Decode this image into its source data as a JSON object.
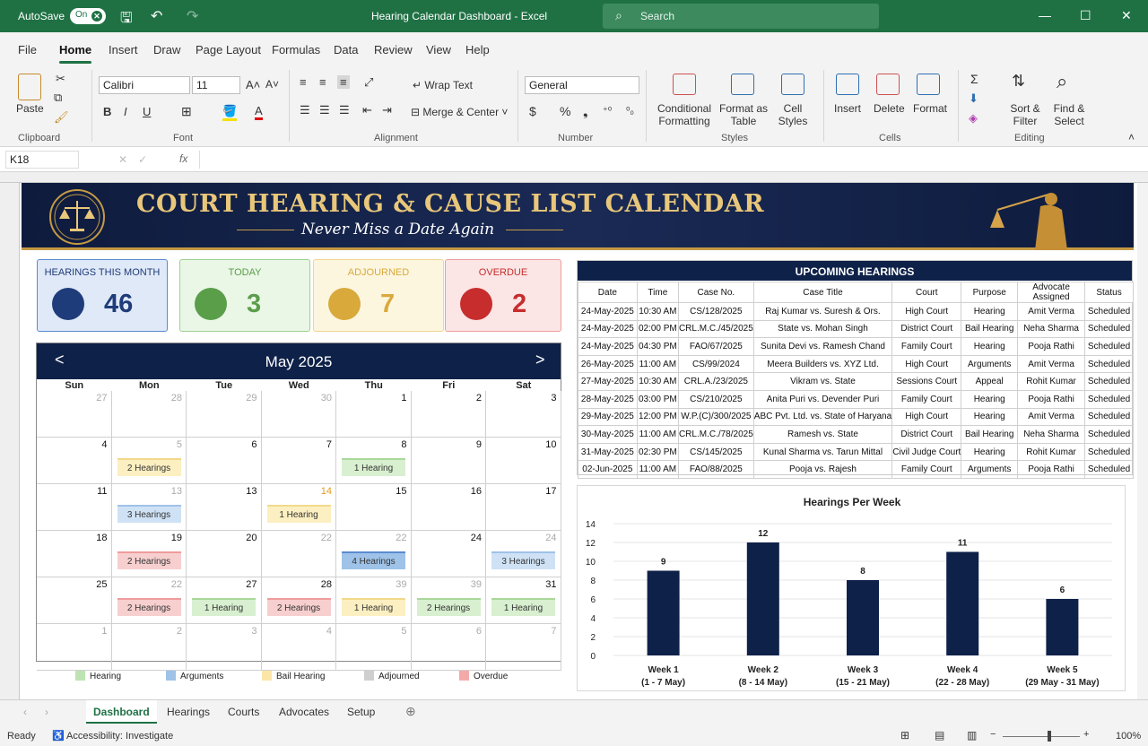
{
  "titlebar": {
    "autosave": "AutoSave",
    "toggle": "On",
    "title": "Hearing Calendar Dashboard - Excel",
    "search": "Search"
  },
  "menu": [
    "File",
    "Home",
    "Insert",
    "Draw",
    "Page Layout",
    "Formulas",
    "Data",
    "Review",
    "View",
    "Help"
  ],
  "ribbon": {
    "paste": "Paste",
    "font_name": "Calibri",
    "font_size": "11",
    "wrap": "Wrap Text",
    "merge": "Merge & Center",
    "number_format": "General",
    "cond": [
      "Conditional",
      "Formatting"
    ],
    "fmt_table": [
      "Format as",
      "Table"
    ],
    "cell_styles": [
      "Cell",
      "Styles"
    ],
    "insert": "Insert",
    "delete": "Delete",
    "format": "Format",
    "sort": [
      "Sort &",
      "Filter"
    ],
    "find": [
      "Find &",
      "Select"
    ],
    "groups": [
      "Clipboard",
      "Font",
      "Alignment",
      "Number",
      "Styles",
      "Cells",
      "Editing"
    ]
  },
  "namebox": "K18",
  "banner": {
    "title": "COURT HEARING & CAUSE LIST CALENDAR",
    "subtitle": "Never Miss a Date Again"
  },
  "kpis": [
    {
      "label": "HEARINGS THIS MONTH",
      "value": "46",
      "color": "#1f3c7a",
      "bg": "#dfe9f7",
      "border": "#5b8bd0"
    },
    {
      "label": "TODAY",
      "value": "3",
      "color": "#5a9e4a",
      "bg": "#eaf6e6",
      "border": "#9fd08f"
    },
    {
      "label": "ADJOURNED",
      "value": "7",
      "color": "#d9a93c",
      "bg": "#fdf6df",
      "border": "#f0d591"
    },
    {
      "label": "OVERDUE",
      "value": "2",
      "color": "#c72d2d",
      "bg": "#fbe5e5",
      "border": "#ee9c9c"
    }
  ],
  "calendar": {
    "month": "May 2025",
    "prev": "<",
    "next": ">",
    "days": [
      "Sun",
      "Mon",
      "Tue",
      "Wed",
      "Thu",
      "Fri",
      "Sat"
    ],
    "weeks": [
      [
        {
          "d": "27",
          "f": true
        },
        {
          "d": "28",
          "f": true
        },
        {
          "d": "29",
          "f": true
        },
        {
          "d": "30",
          "f": true
        },
        {
          "d": "1"
        },
        {
          "d": "2"
        },
        {
          "d": "3"
        }
      ],
      [
        {
          "d": "4"
        },
        {
          "d": "5",
          "f": true,
          "chip": "2 Hearings",
          "c": "yellow"
        },
        {
          "d": "6"
        },
        {
          "d": "7"
        },
        {
          "d": "8",
          "chip": "1 Hearing",
          "c": "green"
        },
        {
          "d": "9"
        },
        {
          "d": "10"
        }
      ],
      [
        {
          "d": "11"
        },
        {
          "d": "13",
          "f": true,
          "chip": "3 Hearings",
          "c": "blue"
        },
        {
          "d": "13"
        },
        {
          "d": "14",
          "hl": true,
          "chip": "1 Hearing",
          "c": "yellow"
        },
        {
          "d": "15"
        },
        {
          "d": "16"
        },
        {
          "d": "17"
        }
      ],
      [
        {
          "d": "18"
        },
        {
          "d": "19",
          "chip": "2 Hearings",
          "c": "red"
        },
        {
          "d": "20"
        },
        {
          "d": "22",
          "f": true
        },
        {
          "d": "22",
          "f": true,
          "chip": "4 Hearings",
          "c": "bluedark"
        },
        {
          "d": "24"
        },
        {
          "d": "24",
          "f": true,
          "chip": "3 Hearings",
          "c": "blue"
        }
      ],
      [
        {
          "d": "25"
        },
        {
          "d": "22",
          "f": true,
          "chip": "2 Hearings",
          "c": "red"
        },
        {
          "d": "27",
          "chip": "1 Hearing",
          "c": "green"
        },
        {
          "d": "28",
          "chip": "2 Hearings",
          "c": "red"
        },
        {
          "d": "39",
          "f": true,
          "chip": "1 Hearing",
          "c": "yellow"
        },
        {
          "d": "39",
          "f": true,
          "chip": "2 Hearings",
          "c": "green"
        },
        {
          "d": "31",
          "chip": "1 Hearing",
          "c": "green"
        }
      ],
      [
        {
          "d": "1",
          "f": true
        },
        {
          "d": "2",
          "f": true
        },
        {
          "d": "3",
          "f": true
        },
        {
          "d": "4",
          "f": true
        },
        {
          "d": "5",
          "f": true
        },
        {
          "d": "6",
          "f": true
        },
        {
          "d": "7",
          "f": true
        }
      ]
    ],
    "legend": [
      {
        "label": "Hearing",
        "color": "#bfe3b4"
      },
      {
        "label": "Arguments",
        "color": "#9fc2e8"
      },
      {
        "label": "Bail Hearing",
        "color": "#fbe6a8"
      },
      {
        "label": "Adjourned",
        "color": "#cfcfcf"
      },
      {
        "label": "Overdue",
        "color": "#f4a9a9"
      }
    ]
  },
  "upcoming": {
    "title": "UPCOMING HEARINGS",
    "columns": [
      "Date",
      "Time",
      "Case No.",
      "Case Title",
      "Court",
      "Purpose",
      "Advocate Assigned",
      "Status"
    ],
    "rows": [
      [
        "24-May-2025",
        "10:30 AM",
        "CS/128/2025",
        "Raj Kumar vs. Suresh & Ors.",
        "High Court",
        "Hearing",
        "Amit Verma",
        "Scheduled"
      ],
      [
        "24-May-2025",
        "02:00 PM",
        "CRL.M.C./45/2025",
        "State vs. Mohan Singh",
        "District Court",
        "Bail Hearing",
        "Neha Sharma",
        "Scheduled"
      ],
      [
        "24-May-2025",
        "04:30 PM",
        "FAO/67/2025",
        "Sunita Devi vs. Ramesh Chand",
        "Family Court",
        "Hearing",
        "Pooja Rathi",
        "Scheduled"
      ],
      [
        "26-May-2025",
        "11:00 AM",
        "CS/99/2024",
        "Meera Builders vs. XYZ Ltd.",
        "High Court",
        "Arguments",
        "Amit Verma",
        "Scheduled"
      ],
      [
        "27-May-2025",
        "10:30 AM",
        "CRL.A./23/2025",
        "Vikram vs. State",
        "Sessions Court",
        "Appeal",
        "Rohit Kumar",
        "Scheduled"
      ],
      [
        "28-May-2025",
        "03:00 PM",
        "CS/210/2025",
        "Anita Puri vs. Devender Puri",
        "Family Court",
        "Hearing",
        "Pooja Rathi",
        "Scheduled"
      ],
      [
        "29-May-2025",
        "12:00 PM",
        "W.P.(C)/300/2025",
        "ABC Pvt. Ltd. vs. State of Haryana",
        "High Court",
        "Hearing",
        "Amit Verma",
        "Scheduled"
      ],
      [
        "30-May-2025",
        "11:00 AM",
        "CRL.M.C./78/2025",
        "Ramesh vs. State",
        "District Court",
        "Bail Hearing",
        "Neha Sharma",
        "Scheduled"
      ],
      [
        "31-May-2025",
        "02:30 PM",
        "CS/145/2025",
        "Kunal Sharma vs. Tarun Mittal",
        "Civil Judge Court",
        "Hearing",
        "Rohit Kumar",
        "Scheduled"
      ],
      [
        "02-Jun-2025",
        "11:00 AM",
        "FAO/88/2025",
        "Pooja vs. Rajesh",
        "Family Court",
        "Arguments",
        "Pooja Rathi",
        "Scheduled"
      ]
    ]
  },
  "chart_data": {
    "type": "bar",
    "title": "Hearings Per Week",
    "categories": [
      "Week 1",
      "Week 2",
      "Week 3",
      "Week 4",
      "Week 5"
    ],
    "subcategories": [
      "(1 - 7 May)",
      "(8 - 14 May)",
      "(15 - 21 May)",
      "(22 - 28 May)",
      "(29 May - 31 May)"
    ],
    "values": [
      9,
      12,
      8,
      11,
      6
    ],
    "ylim": [
      0,
      14
    ],
    "yticks": [
      0,
      2,
      4,
      6,
      8,
      10,
      12,
      14
    ],
    "color": "#0e2149",
    "grid": true
  },
  "sheets": [
    "Dashboard",
    "Hearings",
    "Courts",
    "Advocates",
    "Setup"
  ],
  "status": {
    "ready": "Ready",
    "accessibility": "Accessibility: Investigate",
    "zoom": "100%"
  }
}
